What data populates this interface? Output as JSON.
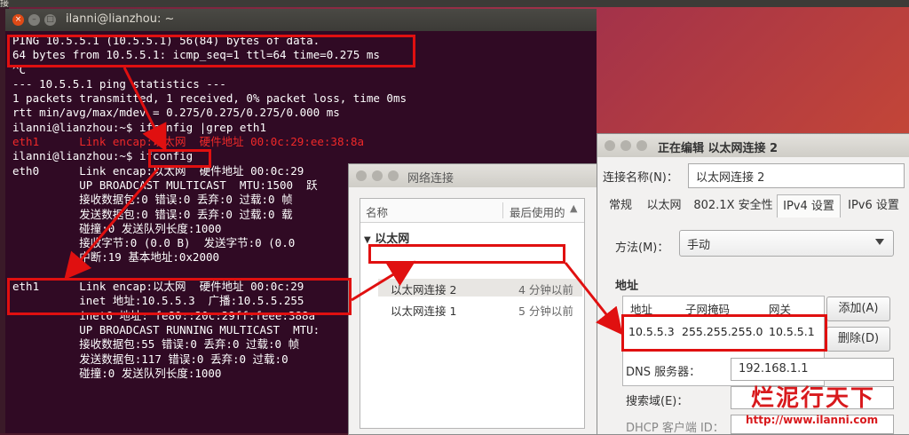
{
  "desktop": {
    "topbar_title": "接"
  },
  "terminal": {
    "title": "ilanni@lianzhou: ~",
    "lines": [
      "PING 10.5.5.1 (10.5.5.1) 56(84) bytes of data.",
      "64 bytes from 10.5.5.1: icmp_seq=1 ttl=64 time=0.275 ms",
      "^C",
      "--- 10.5.5.1 ping statistics ---",
      "1 packets transmitted, 1 received, 0% packet loss, time 0ms",
      "rtt min/avg/max/mdev = 0.275/0.275/0.275/0.000 ms",
      "ilanni@lianzhou:~$ ifconfig |grep eth1",
      "eth1      Link encap:以太网  硬件地址 00:0c:29:ee:38:8a",
      "ilanni@lianzhou:~$ ifconfig",
      "eth0      Link encap:以太网  硬件地址 00:0c:29",
      "          UP BROADCAST MULTICAST  MTU:1500  跃",
      "          接收数据包:0 错误:0 丢弃:0 过载:0 帧",
      "          发送数据包:0 错误:0 丢弃:0 过载:0 载",
      "          碰撞:0 发送队列长度:1000",
      "          接收字节:0 (0.0 B)  发送字节:0 (0.0",
      "          中断:19 基本地址:0x2000",
      "",
      "eth1      Link encap:以太网  硬件地址 00:0c:29",
      "          inet 地址:10.5.5.3  广播:10.5.5.255",
      "          inet6 地址: fe80::20c:29ff:feee:388a",
      "          UP BROADCAST RUNNING MULTICAST  MTU:",
      "          接收数据包:55 错误:0 丢弃:0 过载:0 帧",
      "          发送数据包:117 错误:0 丢弃:0 过载:0",
      "          碰撞:0 发送队列长度:1000"
    ],
    "colors": {
      "background": "#300a24",
      "text": "#ffffff",
      "highlight": "#ef2929"
    }
  },
  "network_window": {
    "title": "网络连接",
    "col_name": "名称",
    "col_last_used": "最后使用的",
    "group": "以太网",
    "rows": [
      {
        "name": "以太网连接 2",
        "last_used": "4 分钟以前"
      },
      {
        "name": "以太网连接 1",
        "last_used": "5 分钟以前"
      }
    ]
  },
  "edit_window": {
    "title": "正在编辑 以太网连接 2",
    "conn_name_label": "连接名称(N)：",
    "conn_name_value": "以太网连接 2",
    "tabs": [
      "常规",
      "以太网",
      "802.1X 安全性",
      "IPv4 设置",
      "IPv6 设置"
    ],
    "active_tab": "IPv4 设置",
    "method_label": "方法(M)：",
    "method_value": "手动",
    "address_section": "地址",
    "address_headers": [
      "地址",
      "子网掩码",
      "网关"
    ],
    "address_row": [
      "10.5.5.3",
      "255.255.255.0",
      "10.5.5.1"
    ],
    "add_button": "添加(A)",
    "delete_button": "删除(D)",
    "dns_label": "DNS 服务器：",
    "dns_value": "192.168.1.1",
    "search_label": "搜索域(E)：",
    "search_value": "",
    "dhcp_label": "DHCP 客户端 ID：",
    "dhcp_value": ""
  },
  "watermark": {
    "logo": "烂泥行天下",
    "url": "http://www.ilanni.com"
  },
  "annotation_color": "#e01010"
}
